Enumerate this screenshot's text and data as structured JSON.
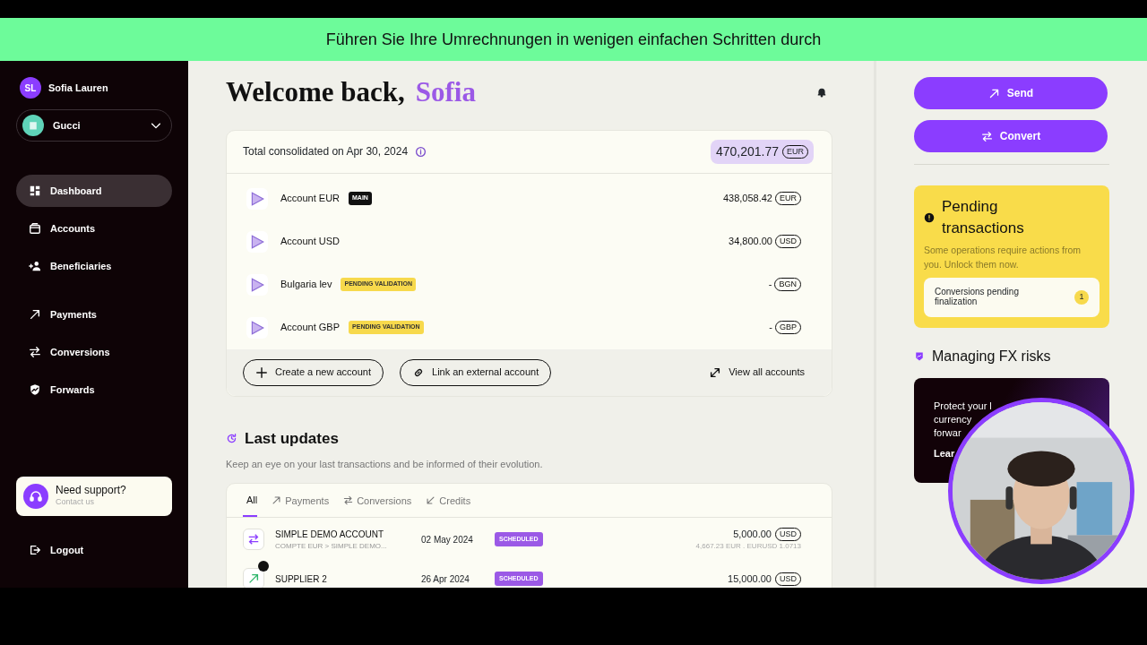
{
  "banner": {
    "text": "Führen Sie Ihre Umrechnungen in wenigen einfachen Schritten durch"
  },
  "sidebar": {
    "user": {
      "initials": "SL",
      "name": "Sofia Lauren"
    },
    "company": {
      "name": "Gucci"
    },
    "nav": [
      {
        "items": [
          {
            "label": "Dashboard",
            "kind": "dashboard",
            "selected": true
          },
          {
            "label": "Accounts",
            "kind": "accounts",
            "selected": false
          },
          {
            "label": "Beneficiaries",
            "kind": "beneficiaries",
            "selected": false
          }
        ]
      },
      {
        "items": [
          {
            "label": "Payments",
            "kind": "payments",
            "selected": false
          },
          {
            "label": "Conversions",
            "kind": "conversions",
            "selected": false
          },
          {
            "label": "Forwards",
            "kind": "forwards",
            "selected": false
          }
        ]
      }
    ],
    "support": {
      "title": "Need support?",
      "subtitle": "Contact us"
    },
    "logout": {
      "label": "Logout"
    }
  },
  "welcome": {
    "greeting": "Welcome back,",
    "name": "Sofia"
  },
  "total": {
    "label": "Total consolidated on Apr 30, 2024",
    "amount": "470,201.77",
    "currency": "EUR"
  },
  "accounts": [
    {
      "name": "Account EUR",
      "tag": {
        "kind": "main",
        "text": "MAIN"
      },
      "amount": "438,058.42",
      "currency": "EUR"
    },
    {
      "name": "Account USD",
      "amount": "34,800.00",
      "currency": "USD"
    },
    {
      "name": "Bulgaria lev",
      "tag": {
        "kind": "pending",
        "text": "PENDING VALIDATION"
      },
      "amount": "-",
      "currency": "BGN"
    },
    {
      "name": "Account GBP",
      "tag": {
        "kind": "pending",
        "text": "PENDING VALIDATION"
      },
      "amount": "-",
      "currency": "GBP"
    }
  ],
  "account_actions": [
    {
      "label": "Create a new account",
      "kind": "create"
    },
    {
      "label": "Link an external account",
      "kind": "link"
    }
  ],
  "view_all": {
    "label": "View all accounts"
  },
  "updates": {
    "title": "Last updates",
    "subtitle": "Keep an eye on your last transactions and be informed of their evolution.",
    "tabs": [
      {
        "label": "All",
        "kind": "all",
        "selected": true
      },
      {
        "label": "Payments",
        "kind": "payments",
        "selected": false
      },
      {
        "label": "Conversions",
        "kind": "conversions",
        "selected": false
      },
      {
        "label": "Credits",
        "kind": "credits",
        "selected": false
      }
    ],
    "rows": [
      {
        "kind": "conversion",
        "title": "SIMPLE DEMO ACCOUNT",
        "subtitle": "COMPTE EUR > SIMPLE DEMO...",
        "date": "02 May 2024",
        "status": "SCHEDULED",
        "amount": "5,000.00",
        "currency": "USD",
        "detail": "4,667.23 EUR . EURUSD 1.0713"
      },
      {
        "kind": "payment",
        "title": "SUPPLIER 2",
        "date": "26 Apr 2024",
        "status": "SCHEDULED",
        "amount": "15,000.00",
        "currency": "USD"
      }
    ]
  },
  "actions": [
    {
      "label": "Send",
      "kind": "payments"
    },
    {
      "label": "Convert",
      "kind": "conversions"
    }
  ],
  "pending": {
    "title": "Pending transactions",
    "text": "Some operations require actions from you. Unlock them now.",
    "item": {
      "label": "Conversions pending finalization",
      "count": "1"
    }
  },
  "fx": {
    "title": "Managing FX risks",
    "lines": [
      "Protect your l",
      "currency",
      "forwar",
      "Lear"
    ]
  }
}
